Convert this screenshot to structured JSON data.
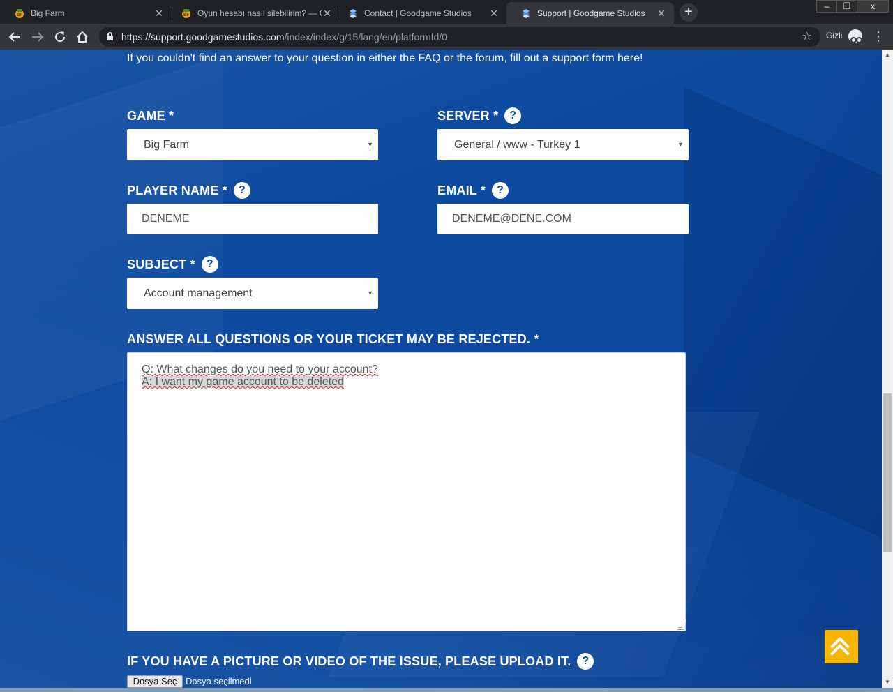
{
  "browser": {
    "tabs": [
      {
        "title": "Big Farm",
        "icon": "big-farm-favicon",
        "active": false
      },
      {
        "title": "Oyun hesabı nasıl silebilirim? — G",
        "icon": "big-farm-favicon",
        "active": false
      },
      {
        "title": "Contact | Goodgame Studios",
        "icon": "goodgame-favicon",
        "active": false
      },
      {
        "title": "Support | Goodgame Studios",
        "icon": "goodgame-favicon",
        "active": true
      }
    ],
    "new_tab": "+",
    "url_host": "https://support.goodgamestudios.com",
    "url_path": "/index/index/g/15/lang/en/platformId/0",
    "incognito_label": "Gizli",
    "window_controls": [
      "–",
      "❐",
      "x"
    ]
  },
  "page": {
    "intro": "If you couldn't find an answer to your question in either the FAQ or the forum, fill out a support form here!",
    "help_glyph": "?",
    "game": {
      "label": "GAME *",
      "value": "Big Farm"
    },
    "server": {
      "label": "SERVER *",
      "value": "General / www - Turkey 1"
    },
    "player_name": {
      "label": "PLAYER NAME *",
      "value": "DENEME"
    },
    "email": {
      "label": "EMAIL *",
      "value": "DENEME@DENE.COM"
    },
    "subject": {
      "label": "SUBJECT *",
      "value": "Account management"
    },
    "answers": {
      "label": "ANSWER ALL QUESTIONS OR YOUR TICKET MAY BE REJECTED. *",
      "question": "Q: What changes do you need to your account?",
      "answer": "A: I want my game account to be deleted"
    },
    "upload": {
      "label": "IF YOU HAVE A PICTURE OR VIDEO OF THE ISSUE, PLEASE UPLOAD IT.",
      "button": "Dosya Seç",
      "status": "Dosya seçilmedi"
    },
    "accent_color": "#f7b500",
    "background_color": "#0c4aa0"
  }
}
